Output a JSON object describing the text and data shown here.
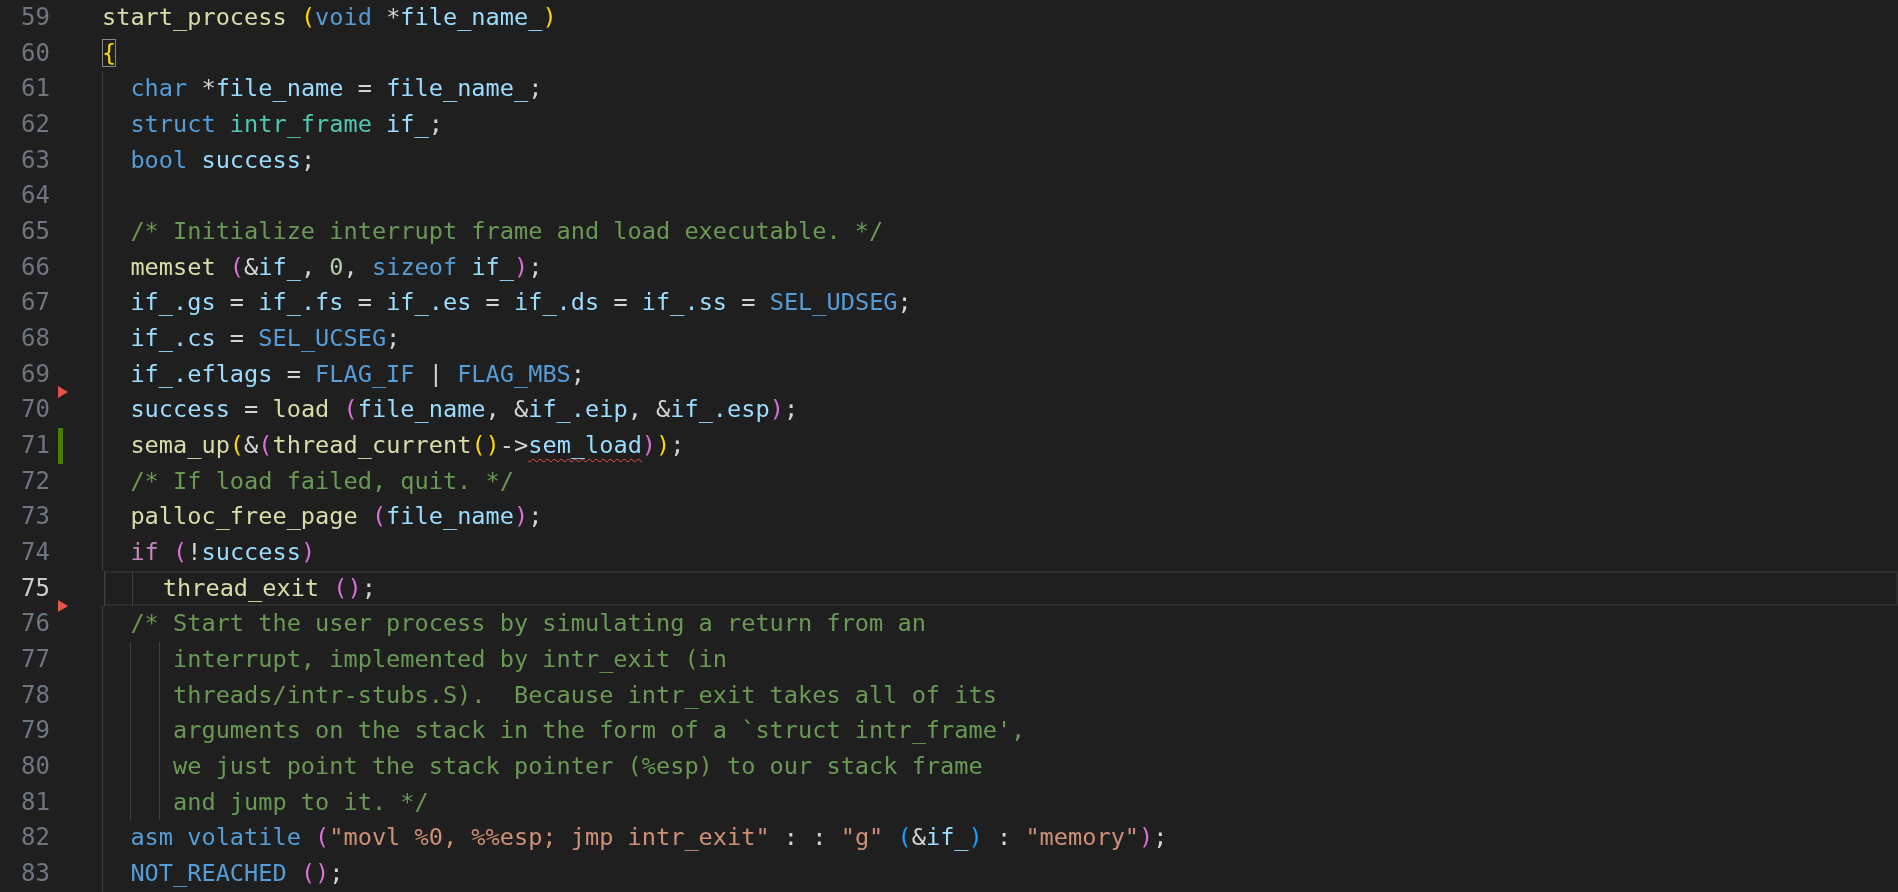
{
  "editor": {
    "lines": [
      {
        "number": "59",
        "current": false,
        "deleted": false,
        "modified": false,
        "tokens": [
          {
            "kind": "func",
            "text": "start_process "
          },
          {
            "kind": "paren1",
            "text": "("
          },
          {
            "kind": "keyword",
            "text": "void"
          },
          {
            "kind": "plain",
            "text": " *"
          },
          {
            "kind": "var",
            "text": "file_name_"
          },
          {
            "kind": "paren1",
            "text": ")"
          }
        ]
      },
      {
        "number": "60",
        "current": false,
        "deleted": false,
        "modified": false,
        "tokens": [
          {
            "kind": "match",
            "text": "{"
          }
        ]
      },
      {
        "number": "61",
        "current": false,
        "deleted": false,
        "modified": false,
        "tokens": [
          {
            "kind": "keyword",
            "text": "  char"
          },
          {
            "kind": "plain",
            "text": " *"
          },
          {
            "kind": "var",
            "text": "file_name"
          },
          {
            "kind": "plain",
            "text": " = "
          },
          {
            "kind": "var",
            "text": "file_name_"
          },
          {
            "kind": "plain",
            "text": ";"
          }
        ]
      },
      {
        "number": "62",
        "current": false,
        "deleted": false,
        "modified": false,
        "tokens": [
          {
            "kind": "keyword",
            "text": "  struct "
          },
          {
            "kind": "type",
            "text": "intr_frame "
          },
          {
            "kind": "var",
            "text": "if_"
          },
          {
            "kind": "plain",
            "text": ";"
          }
        ]
      },
      {
        "number": "63",
        "current": false,
        "deleted": false,
        "modified": false,
        "tokens": [
          {
            "kind": "keyword",
            "text": "  bool "
          },
          {
            "kind": "var",
            "text": "success"
          },
          {
            "kind": "plain",
            "text": ";"
          }
        ]
      },
      {
        "number": "64",
        "current": false,
        "deleted": false,
        "modified": false
      },
      {
        "number": "65",
        "current": false,
        "deleted": false,
        "modified": false,
        "tokens": [
          {
            "kind": "comment",
            "text": "  /* Initialize interrupt frame and load executable. */"
          }
        ]
      },
      {
        "number": "66",
        "current": false,
        "deleted": false,
        "modified": false,
        "tokens": [
          {
            "kind": "func",
            "text": "  memset "
          },
          {
            "kind": "paren2",
            "text": "("
          },
          {
            "kind": "plain",
            "text": "&"
          },
          {
            "kind": "var",
            "text": "if_"
          },
          {
            "kind": "plain",
            "text": ", "
          },
          {
            "kind": "number",
            "text": "0"
          },
          {
            "kind": "plain",
            "text": ", "
          },
          {
            "kind": "keyword",
            "text": "sizeof "
          },
          {
            "kind": "var",
            "text": "if_"
          },
          {
            "kind": "paren2",
            "text": ")"
          },
          {
            "kind": "plain",
            "text": ";"
          }
        ]
      },
      {
        "number": "67",
        "current": false,
        "deleted": false,
        "modified": false,
        "tokens": [
          {
            "kind": "var",
            "text": "  if_.gs"
          },
          {
            "kind": "plain",
            "text": " = "
          },
          {
            "kind": "var",
            "text": "if_.fs"
          },
          {
            "kind": "plain",
            "text": " = "
          },
          {
            "kind": "var",
            "text": "if_.es"
          },
          {
            "kind": "plain",
            "text": " = "
          },
          {
            "kind": "var",
            "text": "if_.ds"
          },
          {
            "kind": "plain",
            "text": " = "
          },
          {
            "kind": "var",
            "text": "if_.ss"
          },
          {
            "kind": "plain",
            "text": " = "
          },
          {
            "kind": "macro",
            "text": "SEL_UDSEG"
          },
          {
            "kind": "plain",
            "text": ";"
          }
        ]
      },
      {
        "number": "68",
        "current": false,
        "deleted": false,
        "modified": false,
        "tokens": [
          {
            "kind": "var",
            "text": "  if_.cs"
          },
          {
            "kind": "plain",
            "text": " = "
          },
          {
            "kind": "macro",
            "text": "SEL_UCSEG"
          },
          {
            "kind": "plain",
            "text": ";"
          }
        ]
      },
      {
        "number": "69",
        "current": false,
        "deleted": false,
        "modified": false,
        "tokens": [
          {
            "kind": "var",
            "text": "  if_.eflags"
          },
          {
            "kind": "plain",
            "text": " = "
          },
          {
            "kind": "macro",
            "text": "FLAG_IF"
          },
          {
            "kind": "plain",
            "text": " | "
          },
          {
            "kind": "macro",
            "text": "FLAG_MBS"
          },
          {
            "kind": "plain",
            "text": ";"
          }
        ]
      },
      {
        "number": "70",
        "current": false,
        "deleted": true,
        "modified": false,
        "tokens": [
          {
            "kind": "var",
            "text": "  success"
          },
          {
            "kind": "plain",
            "text": " = "
          },
          {
            "kind": "func",
            "text": "load "
          },
          {
            "kind": "paren2",
            "text": "("
          },
          {
            "kind": "var",
            "text": "file_name"
          },
          {
            "kind": "plain",
            "text": ", &"
          },
          {
            "kind": "var",
            "text": "if_.eip"
          },
          {
            "kind": "plain",
            "text": ", &"
          },
          {
            "kind": "var",
            "text": "if_.esp"
          },
          {
            "kind": "paren2",
            "text": ")"
          },
          {
            "kind": "plain",
            "text": ";"
          }
        ]
      },
      {
        "number": "71",
        "current": false,
        "deleted": false,
        "modified": true,
        "tokens": [
          {
            "kind": "func",
            "text": "  sema_up"
          },
          {
            "kind": "paren1",
            "text": "("
          },
          {
            "kind": "plain",
            "text": "&"
          },
          {
            "kind": "paren2",
            "text": "("
          },
          {
            "kind": "func",
            "text": "thread_current"
          },
          {
            "kind": "paren1",
            "text": "()"
          },
          {
            "kind": "plain",
            "text": "->"
          },
          {
            "kind": "error",
            "text": "sem_load"
          },
          {
            "kind": "paren2",
            "text": ")"
          },
          {
            "kind": "paren1",
            "text": ")"
          },
          {
            "kind": "plain",
            "text": ";"
          }
        ]
      },
      {
        "number": "72",
        "current": false,
        "deleted": false,
        "modified": false,
        "tokens": [
          {
            "kind": "comment",
            "text": "  /* If load failed, quit. */"
          }
        ]
      },
      {
        "number": "73",
        "current": false,
        "deleted": false,
        "modified": false,
        "tokens": [
          {
            "kind": "func",
            "text": "  palloc_free_page "
          },
          {
            "kind": "paren2",
            "text": "("
          },
          {
            "kind": "var",
            "text": "file_name"
          },
          {
            "kind": "paren2",
            "text": ")"
          },
          {
            "kind": "plain",
            "text": ";"
          }
        ]
      },
      {
        "number": "74",
        "current": false,
        "deleted": false,
        "modified": false,
        "tokens": [
          {
            "kind": "control",
            "text": "  if "
          },
          {
            "kind": "paren2",
            "text": "("
          },
          {
            "kind": "plain",
            "text": "!"
          },
          {
            "kind": "var",
            "text": "success"
          },
          {
            "kind": "paren2",
            "text": ")"
          }
        ]
      },
      {
        "number": "75",
        "current": true,
        "deleted": false,
        "modified": false,
        "tokens": [
          {
            "kind": "func",
            "text": "    thread_exit "
          },
          {
            "kind": "paren2",
            "text": "()"
          },
          {
            "kind": "plain",
            "text": ";"
          }
        ]
      },
      {
        "number": "76",
        "current": false,
        "deleted": true,
        "modified": false,
        "tokens": [
          {
            "kind": "comment",
            "text": "  /* Start the user process by simulating a return from an"
          }
        ]
      },
      {
        "number": "77",
        "current": false,
        "deleted": false,
        "modified": false,
        "tokens": [
          {
            "kind": "comment",
            "text": "     interrupt, implemented by intr_exit (in"
          }
        ]
      },
      {
        "number": "78",
        "current": false,
        "deleted": false,
        "modified": false,
        "tokens": [
          {
            "kind": "comment",
            "text": "     threads/intr-stubs.S).  Because intr_exit takes all of its"
          }
        ]
      },
      {
        "number": "79",
        "current": false,
        "deleted": false,
        "modified": false,
        "tokens": [
          {
            "kind": "comment",
            "text": "     arguments on the stack in the form of a `struct intr_frame',"
          }
        ]
      },
      {
        "number": "80",
        "current": false,
        "deleted": false,
        "modified": false,
        "tokens": [
          {
            "kind": "comment",
            "text": "     we just point the stack pointer (%esp) to our stack frame"
          }
        ]
      },
      {
        "number": "81",
        "current": false,
        "deleted": false,
        "modified": false,
        "tokens": [
          {
            "kind": "comment",
            "text": "     and jump to it. */"
          }
        ]
      },
      {
        "number": "82",
        "current": false,
        "deleted": false,
        "modified": false,
        "tokens": [
          {
            "kind": "keyword",
            "text": "  asm volatile "
          },
          {
            "kind": "paren2",
            "text": "("
          },
          {
            "kind": "string",
            "text": "\"movl %0, %%esp; jmp intr_exit\""
          },
          {
            "kind": "plain",
            "text": " : : "
          },
          {
            "kind": "string",
            "text": "\"g\""
          },
          {
            "kind": "paren3",
            "text": " ("
          },
          {
            "kind": "plain",
            "text": "&"
          },
          {
            "kind": "var",
            "text": "if_"
          },
          {
            "kind": "paren3",
            "text": ")"
          },
          {
            "kind": "plain",
            "text": " : "
          },
          {
            "kind": "string",
            "text": "\"memory\""
          },
          {
            "kind": "paren2",
            "text": ")"
          },
          {
            "kind": "plain",
            "text": ";"
          }
        ]
      },
      {
        "number": "83",
        "current": false,
        "deleted": false,
        "modified": false,
        "tokens": [
          {
            "kind": "macro",
            "text": "  NOT_REACHED "
          },
          {
            "kind": "paren2",
            "text": "()"
          },
          {
            "kind": "plain",
            "text": ";"
          }
        ]
      }
    ]
  }
}
